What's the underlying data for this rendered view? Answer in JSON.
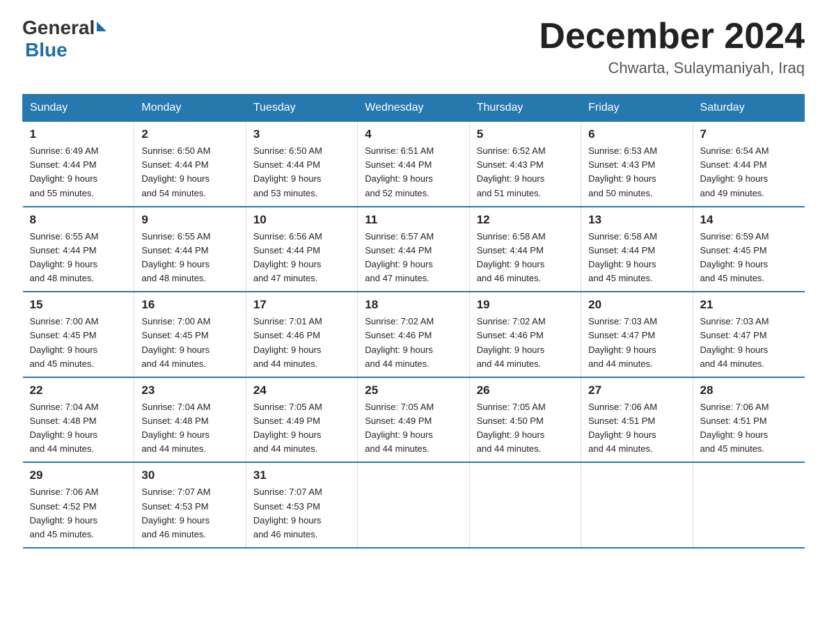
{
  "header": {
    "logo_general": "General",
    "logo_blue": "Blue",
    "month_title": "December 2024",
    "location": "Chwarta, Sulaymaniyah, Iraq"
  },
  "days_of_week": [
    "Sunday",
    "Monday",
    "Tuesday",
    "Wednesday",
    "Thursday",
    "Friday",
    "Saturday"
  ],
  "weeks": [
    [
      {
        "day": "1",
        "sunrise": "6:49 AM",
        "sunset": "4:44 PM",
        "daylight": "9 hours and 55 minutes."
      },
      {
        "day": "2",
        "sunrise": "6:50 AM",
        "sunset": "4:44 PM",
        "daylight": "9 hours and 54 minutes."
      },
      {
        "day": "3",
        "sunrise": "6:50 AM",
        "sunset": "4:44 PM",
        "daylight": "9 hours and 53 minutes."
      },
      {
        "day": "4",
        "sunrise": "6:51 AM",
        "sunset": "4:44 PM",
        "daylight": "9 hours and 52 minutes."
      },
      {
        "day": "5",
        "sunrise": "6:52 AM",
        "sunset": "4:43 PM",
        "daylight": "9 hours and 51 minutes."
      },
      {
        "day": "6",
        "sunrise": "6:53 AM",
        "sunset": "4:43 PM",
        "daylight": "9 hours and 50 minutes."
      },
      {
        "day": "7",
        "sunrise": "6:54 AM",
        "sunset": "4:44 PM",
        "daylight": "9 hours and 49 minutes."
      }
    ],
    [
      {
        "day": "8",
        "sunrise": "6:55 AM",
        "sunset": "4:44 PM",
        "daylight": "9 hours and 48 minutes."
      },
      {
        "day": "9",
        "sunrise": "6:55 AM",
        "sunset": "4:44 PM",
        "daylight": "9 hours and 48 minutes."
      },
      {
        "day": "10",
        "sunrise": "6:56 AM",
        "sunset": "4:44 PM",
        "daylight": "9 hours and 47 minutes."
      },
      {
        "day": "11",
        "sunrise": "6:57 AM",
        "sunset": "4:44 PM",
        "daylight": "9 hours and 47 minutes."
      },
      {
        "day": "12",
        "sunrise": "6:58 AM",
        "sunset": "4:44 PM",
        "daylight": "9 hours and 46 minutes."
      },
      {
        "day": "13",
        "sunrise": "6:58 AM",
        "sunset": "4:44 PM",
        "daylight": "9 hours and 45 minutes."
      },
      {
        "day": "14",
        "sunrise": "6:59 AM",
        "sunset": "4:45 PM",
        "daylight": "9 hours and 45 minutes."
      }
    ],
    [
      {
        "day": "15",
        "sunrise": "7:00 AM",
        "sunset": "4:45 PM",
        "daylight": "9 hours and 45 minutes."
      },
      {
        "day": "16",
        "sunrise": "7:00 AM",
        "sunset": "4:45 PM",
        "daylight": "9 hours and 44 minutes."
      },
      {
        "day": "17",
        "sunrise": "7:01 AM",
        "sunset": "4:46 PM",
        "daylight": "9 hours and 44 minutes."
      },
      {
        "day": "18",
        "sunrise": "7:02 AM",
        "sunset": "4:46 PM",
        "daylight": "9 hours and 44 minutes."
      },
      {
        "day": "19",
        "sunrise": "7:02 AM",
        "sunset": "4:46 PM",
        "daylight": "9 hours and 44 minutes."
      },
      {
        "day": "20",
        "sunrise": "7:03 AM",
        "sunset": "4:47 PM",
        "daylight": "9 hours and 44 minutes."
      },
      {
        "day": "21",
        "sunrise": "7:03 AM",
        "sunset": "4:47 PM",
        "daylight": "9 hours and 44 minutes."
      }
    ],
    [
      {
        "day": "22",
        "sunrise": "7:04 AM",
        "sunset": "4:48 PM",
        "daylight": "9 hours and 44 minutes."
      },
      {
        "day": "23",
        "sunrise": "7:04 AM",
        "sunset": "4:48 PM",
        "daylight": "9 hours and 44 minutes."
      },
      {
        "day": "24",
        "sunrise": "7:05 AM",
        "sunset": "4:49 PM",
        "daylight": "9 hours and 44 minutes."
      },
      {
        "day": "25",
        "sunrise": "7:05 AM",
        "sunset": "4:49 PM",
        "daylight": "9 hours and 44 minutes."
      },
      {
        "day": "26",
        "sunrise": "7:05 AM",
        "sunset": "4:50 PM",
        "daylight": "9 hours and 44 minutes."
      },
      {
        "day": "27",
        "sunrise": "7:06 AM",
        "sunset": "4:51 PM",
        "daylight": "9 hours and 44 minutes."
      },
      {
        "day": "28",
        "sunrise": "7:06 AM",
        "sunset": "4:51 PM",
        "daylight": "9 hours and 45 minutes."
      }
    ],
    [
      {
        "day": "29",
        "sunrise": "7:06 AM",
        "sunset": "4:52 PM",
        "daylight": "9 hours and 45 minutes."
      },
      {
        "day": "30",
        "sunrise": "7:07 AM",
        "sunset": "4:53 PM",
        "daylight": "9 hours and 46 minutes."
      },
      {
        "day": "31",
        "sunrise": "7:07 AM",
        "sunset": "4:53 PM",
        "daylight": "9 hours and 46 minutes."
      },
      null,
      null,
      null,
      null
    ]
  ],
  "labels": {
    "sunrise": "Sunrise:",
    "sunset": "Sunset:",
    "daylight": "Daylight:"
  }
}
